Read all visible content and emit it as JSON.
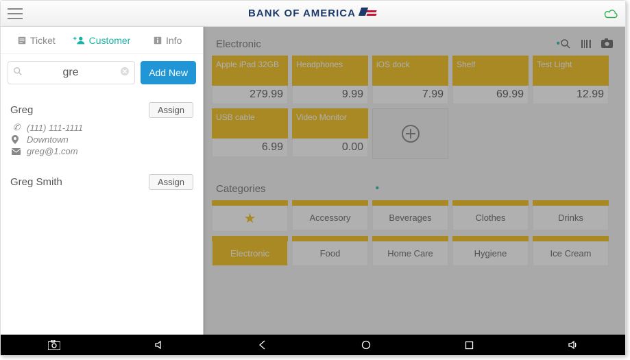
{
  "header": {
    "brand_text": "BANK OF AMERICA"
  },
  "left_panel": {
    "tabs": [
      {
        "id": "ticket",
        "label": "Ticket",
        "active": false
      },
      {
        "id": "customer",
        "label": "Customer",
        "active": true
      },
      {
        "id": "info",
        "label": "Info",
        "active": false
      }
    ],
    "search": {
      "value": "gre",
      "placeholder": ""
    },
    "add_new_label": "Add New",
    "assign_label": "Assign",
    "results": [
      {
        "name": "Greg",
        "phone": "(111) 111-1111",
        "location": "Downtown",
        "email": "greg@1.com"
      },
      {
        "name": "Greg Smith"
      }
    ]
  },
  "right_panel": {
    "products_title": "Electronic",
    "products": [
      {
        "label": "Apple iPad 32GB",
        "price": "279.99"
      },
      {
        "label": "Headphones",
        "price": "9.99"
      },
      {
        "label": "iOS dock",
        "price": "7.99"
      },
      {
        "label": "Shelf",
        "price": "69.99"
      },
      {
        "label": "Test Light",
        "price": "12.99"
      },
      {
        "label": "USB cable",
        "price": "6.99"
      },
      {
        "label": "Video Monitor",
        "price": "0.00"
      }
    ],
    "categories_title": "Categories",
    "categories": [
      {
        "label": "★",
        "fav": true
      },
      {
        "label": "Accessory"
      },
      {
        "label": "Beverages"
      },
      {
        "label": "Clothes"
      },
      {
        "label": "Drinks"
      },
      {
        "label": "Electronic",
        "active": true
      },
      {
        "label": "Food"
      },
      {
        "label": "Home Care"
      },
      {
        "label": "Hygiene"
      },
      {
        "label": "Ice Cream"
      }
    ]
  }
}
